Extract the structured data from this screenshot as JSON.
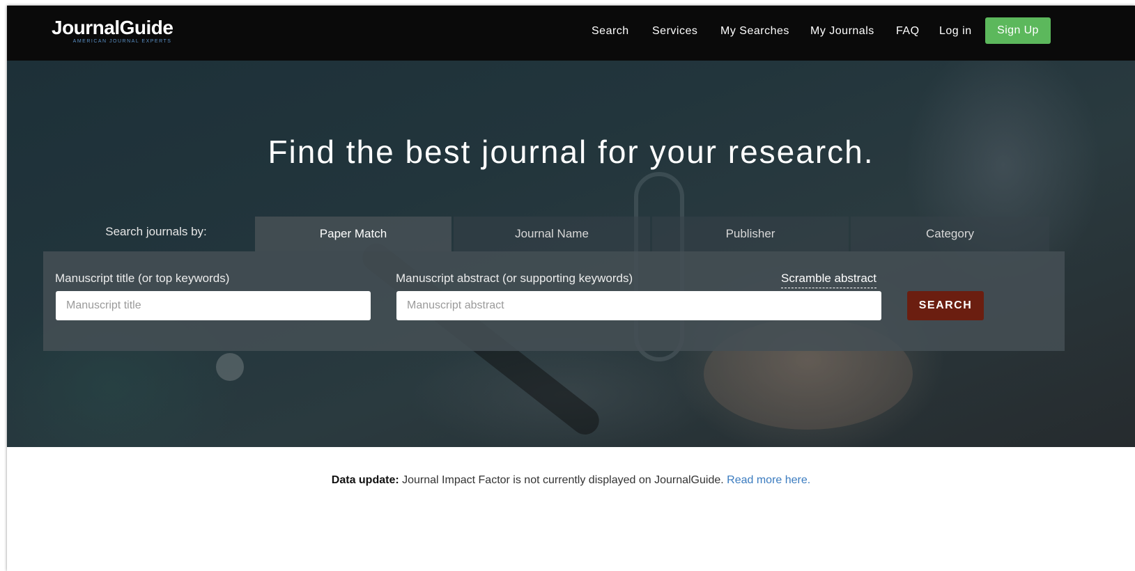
{
  "header": {
    "logo_name": "JournalGuide",
    "logo_tagline": "AMERICAN JOURNAL EXPERTS",
    "nav": {
      "search": "Search",
      "services": "Services",
      "my_searches": "My Searches",
      "my_journals": "My Journals",
      "faq": "FAQ",
      "login": "Log in"
    },
    "signup_label": "Sign Up"
  },
  "hero": {
    "title": "Find the best journal for your research.",
    "search_by_label": "Search journals by:",
    "tabs": [
      "Paper Match",
      "Journal Name",
      "Publisher",
      "Category"
    ],
    "active_tab": "Paper Match"
  },
  "form": {
    "title_label": "Manuscript title (or top keywords)",
    "title_placeholder": "Manuscript title",
    "abstract_label": "Manuscript abstract (or supporting keywords)",
    "abstract_placeholder": "Manuscript abstract",
    "scramble_label": "Scramble abstract",
    "search_button": "SEARCH"
  },
  "notice": {
    "prefix": "Data update:",
    "text": " Journal Impact Factor is not currently displayed on JournalGuide. ",
    "link": "Read more here."
  },
  "colors": {
    "topbar": "#0a0a0a",
    "signup": "#5cb85c",
    "search_button": "#6b1e10",
    "link": "#3a7bbf"
  }
}
